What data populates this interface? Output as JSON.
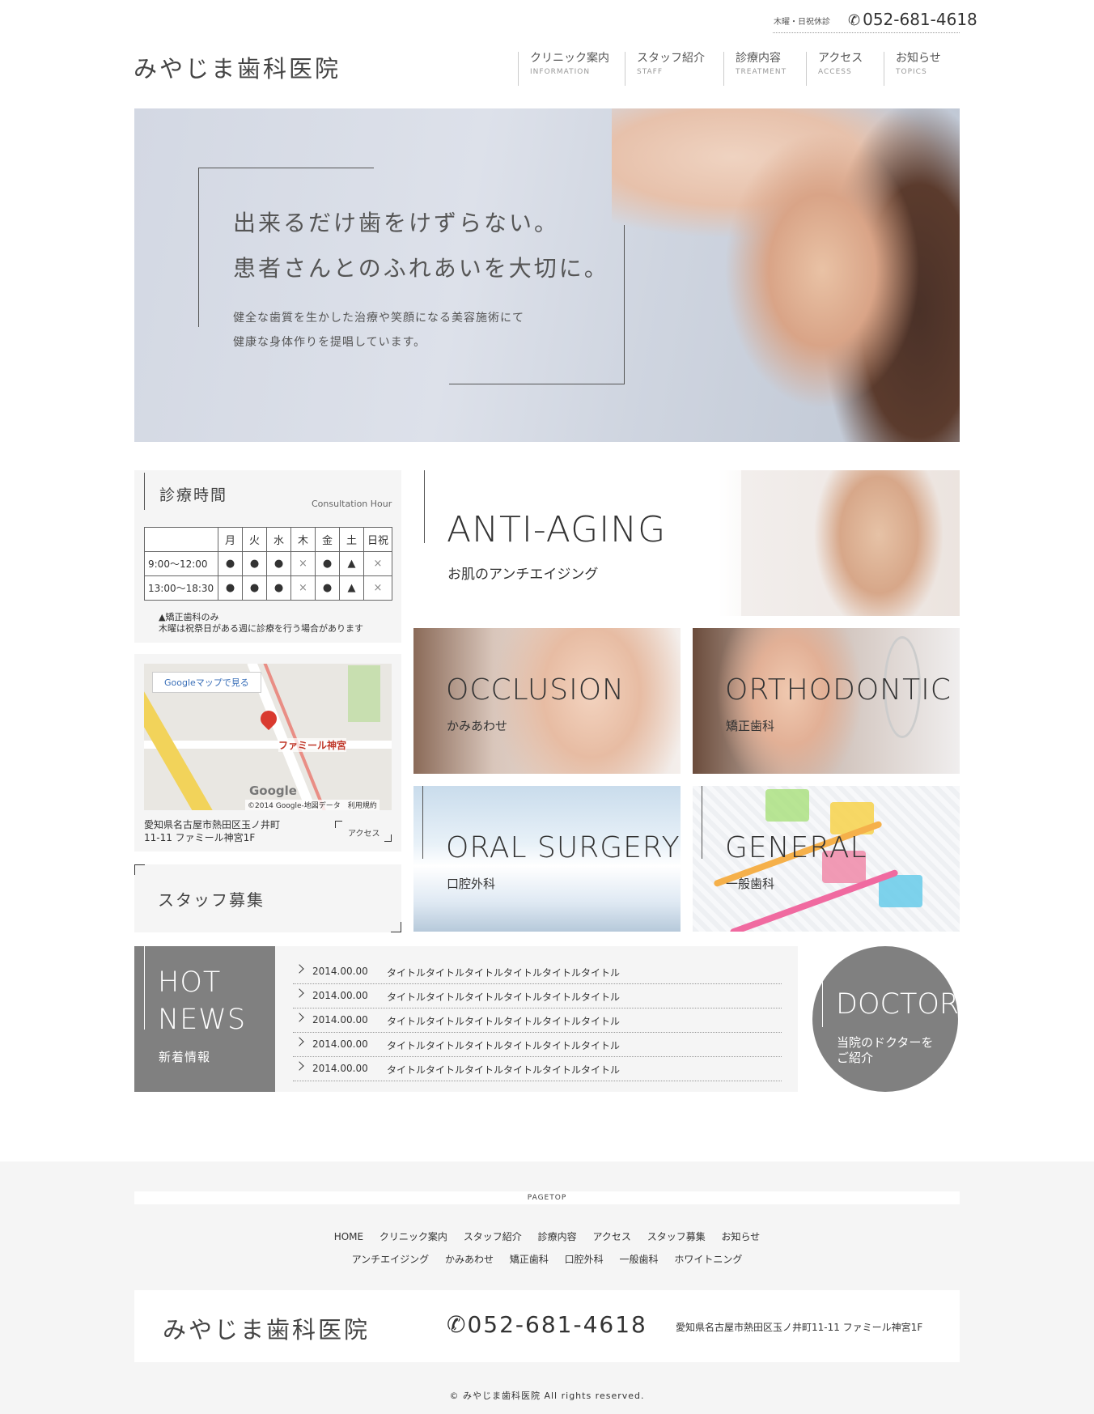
{
  "header": {
    "closed_note": "木曜・日祝休診",
    "phone": "052-681-4618",
    "logo": "みやじま歯科医院",
    "nav": [
      {
        "ja": "クリニック案内",
        "en": "INFORMATION"
      },
      {
        "ja": "スタッフ紹介",
        "en": "STAFF"
      },
      {
        "ja": "診療内容",
        "en": "TREATMENT"
      },
      {
        "ja": "アクセス",
        "en": "ACCESS"
      },
      {
        "ja": "お知らせ",
        "en": "TOPICS"
      }
    ]
  },
  "hero": {
    "headline_1": "出来るだけ歯をけずらない。",
    "headline_2": "患者さんとのふれあいを大切に。",
    "body_1": "健全な歯質を生かした治療や笑顔になる美容施術にて",
    "body_2": "健康な身体作りを提唱しています。"
  },
  "hours": {
    "title": "診療時間",
    "title_en": "Consultation Hour",
    "days": [
      "月",
      "火",
      "水",
      "木",
      "金",
      "土",
      "日祝"
    ],
    "rows": [
      {
        "time": "9:00〜12:00",
        "marks": [
          "●",
          "●",
          "●",
          "×",
          "●",
          "▲",
          "×"
        ]
      },
      {
        "time": "13:00〜18:30",
        "marks": [
          "●",
          "●",
          "●",
          "×",
          "●",
          "▲",
          "×"
        ]
      }
    ],
    "note_1": "▲矯正歯科のみ",
    "note_2": "木曜は祝祭日がある週に診療を行う場合があります"
  },
  "map": {
    "view_button": "Googleマップで見る",
    "place": "ファミール神宮",
    "logo": "Google",
    "copyright": "©2014 Google-地図データ　利用規約",
    "address_1": "愛知県名古屋市熱田区玉ノ井町",
    "address_2": "11-11 ファミール神宮1F",
    "access_label": "アクセス"
  },
  "recruit": {
    "label": "スタッフ募集"
  },
  "features": {
    "anti": {
      "title": "ANTI-AGING",
      "sub": "お肌のアンチエイジング"
    },
    "occlusion": {
      "title": "OCCLUSION",
      "sub": "かみあわせ"
    },
    "orthodontic": {
      "title": "ORTHODONTIC",
      "sub": "矯正歯科"
    },
    "oral": {
      "title": "ORAL SURGERY",
      "sub": "口腔外科"
    },
    "general": {
      "title": "GENERAL",
      "sub": "一般歯科"
    }
  },
  "news": {
    "title_1": "HOT",
    "title_2": "NEWS",
    "sub": "新着情報",
    "items": [
      {
        "date": "2014.00.00",
        "title": "タイトルタイトルタイトルタイトルタイトルタイトル"
      },
      {
        "date": "2014.00.00",
        "title": "タイトルタイトルタイトルタイトルタイトルタイトル"
      },
      {
        "date": "2014.00.00",
        "title": "タイトルタイトルタイトルタイトルタイトルタイトル"
      },
      {
        "date": "2014.00.00",
        "title": "タイトルタイトルタイトルタイトルタイトルタイトル"
      },
      {
        "date": "2014.00.00",
        "title": "タイトルタイトルタイトルタイトルタイトルタイトル"
      }
    ]
  },
  "doctor": {
    "title": "DOCTOR",
    "sub_1": "当院のドクターを",
    "sub_2": "ご紹介"
  },
  "footer": {
    "pagetop": "PAGETOP",
    "nav_1": [
      "HOME",
      "クリニック案内",
      "スタッフ紹介",
      "診療内容",
      "アクセス",
      "スタッフ募集",
      "お知らせ"
    ],
    "nav_2": [
      "アンチエイジング",
      "かみあわせ",
      "矯正歯科",
      "口腔外科",
      "一般歯科",
      "ホワイトニング"
    ],
    "logo": "みやじま歯科医院",
    "phone": "052-681-4618",
    "address": "愛知県名古屋市熱田区玉ノ井町11-11 ファミール神宮1F",
    "copyright": "© みやじま歯科医院 All rights reserved."
  }
}
